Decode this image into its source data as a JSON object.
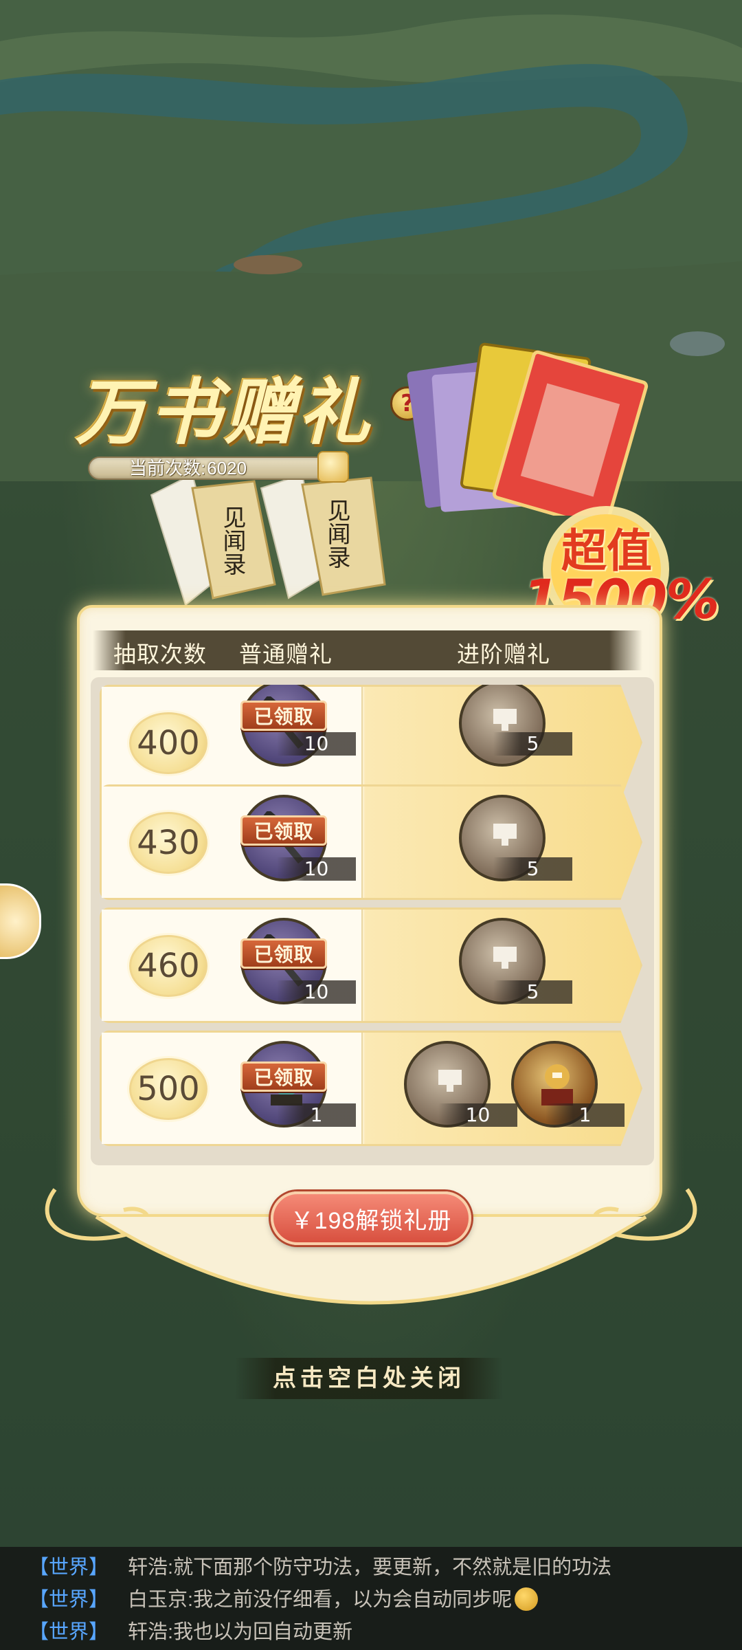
{
  "header": {
    "title": "万书赠礼",
    "help_glyph": "?",
    "count_label": "当前次数:",
    "count_value": "6020",
    "booklet_text": "见闻录",
    "value_badge_top": "超值",
    "value_badge_bottom": "1500%"
  },
  "table": {
    "col_count": "抽取次数",
    "col_normal": "普通赠礼",
    "col_advanced": "进阶赠礼",
    "claimed_label": "已领取",
    "rows": [
      {
        "count": "400",
        "normal_qty": "10",
        "advanced": [
          {
            "qty": "5",
            "icon": "scroll-bundle-icon"
          }
        ]
      },
      {
        "count": "430",
        "normal_qty": "10",
        "advanced": [
          {
            "qty": "5",
            "icon": "scroll-bundle-icon"
          }
        ]
      },
      {
        "count": "460",
        "normal_qty": "10",
        "advanced": [
          {
            "qty": "5",
            "icon": "scroll-bundle-icon"
          }
        ]
      },
      {
        "count": "500",
        "normal_qty": "1",
        "advanced": [
          {
            "qty": "10",
            "icon": "scroll-bundle-icon"
          },
          {
            "qty": "1",
            "icon": "treasure-chest-icon"
          }
        ]
      }
    ]
  },
  "unlock_button": "￥198解锁礼册",
  "close_hint": "点击空白处关闭",
  "chat": [
    {
      "channel": "【世界】",
      "user": "轩浩:",
      "message": "就下面那个防守功法，要更新，不然就是旧的功法",
      "emoji": false
    },
    {
      "channel": "【世界】",
      "user": "白玉京:",
      "message": "我之前没仔细看，以为会自动同步呢",
      "emoji": true
    },
    {
      "channel": "【世界】",
      "user": "轩浩:",
      "message": "我也以为回自动更新",
      "emoji": false
    }
  ],
  "colors": {
    "accent_red": "#d8503f",
    "panel_bg": "#fbf5e2",
    "chat_channel": "#58a6ff"
  }
}
